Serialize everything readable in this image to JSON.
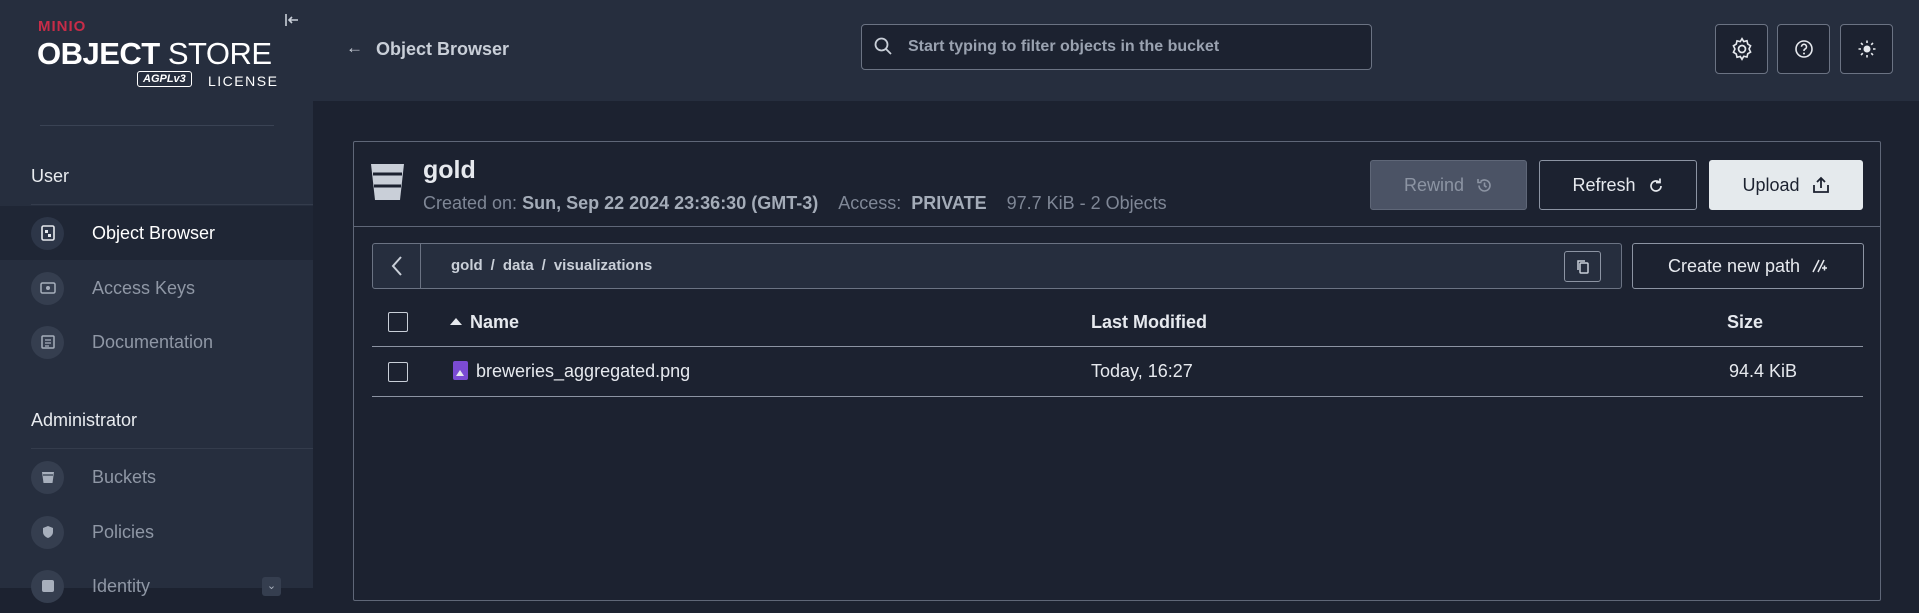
{
  "logo": {
    "brand": "MINIO",
    "product_bold": "OBJECT",
    "product_light": "STORE",
    "badge": "AGPLv3",
    "license": "LICENSE"
  },
  "sidebar": {
    "sections": [
      {
        "label": "User",
        "items": [
          {
            "label": "Object Browser",
            "icon": "object-browser-icon",
            "active": true
          },
          {
            "label": "Access Keys",
            "icon": "key-icon"
          },
          {
            "label": "Documentation",
            "icon": "documentation-icon"
          }
        ]
      },
      {
        "label": "Administrator",
        "items": [
          {
            "label": "Buckets",
            "icon": "bucket-icon"
          },
          {
            "label": "Policies",
            "icon": "shield-icon"
          },
          {
            "label": "Identity",
            "icon": "identity-icon"
          }
        ]
      }
    ]
  },
  "header": {
    "title": "Object Browser",
    "search_placeholder": "Start typing to filter objects in the bucket"
  },
  "bucket": {
    "name": "gold",
    "created_label": "Created on:",
    "created_value": "Sun, Sep 22 2024 23:36:30 (GMT-3)",
    "access_label": "Access:",
    "access_value": "PRIVATE",
    "size_summary": "97.7 KiB - 2 Objects"
  },
  "actions": {
    "rewind": "Rewind",
    "refresh": "Refresh",
    "upload": "Upload",
    "create_path": "Create new path"
  },
  "breadcrumb": [
    "gold",
    "data",
    "visualizations"
  ],
  "breadcrumb_sep": "/",
  "table": {
    "columns": [
      "Name",
      "Last Modified",
      "Size"
    ],
    "rows": [
      {
        "name": "breweries_aggregated.png",
        "modified": "Today, 16:27",
        "size": "94.4 KiB"
      }
    ]
  },
  "colors": {
    "accent": "#c72c48",
    "file_icon": "#7b4bd3"
  }
}
